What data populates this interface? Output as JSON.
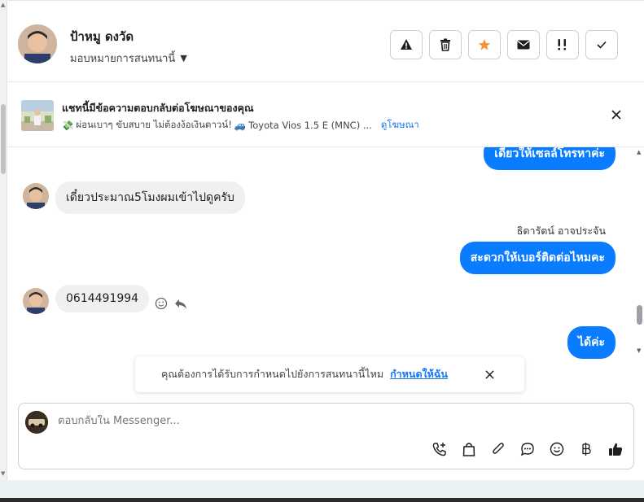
{
  "header": {
    "contact_name": "ป้าหมู ดงวัด",
    "assign_label": "มอบหมายการสนทนานี้"
  },
  "ad": {
    "title": "แชทนี้มีข้อความตอบกลับต่อโฆษณาของคุณ",
    "subtitle": "ผ่อนเบาๆ ขับสบาย ไม่ต้องง้อเงินดาวน์!",
    "car": "Toyota Vios 1.5 E (MNC) ...",
    "view_ad_link": "ดูโฆษณา"
  },
  "messages": [
    {
      "direction": "out",
      "text": "เดี๋ยวให้เซลล์โทรหาค่ะ"
    },
    {
      "direction": "in",
      "text": "เดี๋ยวประมาณ5โมงผมเข้าไปดูครับ"
    },
    {
      "direction": "out",
      "sender": "ธิดารัตน์ อาจประจัน",
      "text": "สะดวกให้เบอร์ติดต่อไหมคะ"
    },
    {
      "direction": "in",
      "text": "0614491994"
    },
    {
      "direction": "out",
      "text": "ได้ค่ะ"
    }
  ],
  "notice": {
    "text": "คุณต้องการได้รับการกำหนดไปยังการสนทนานี้ไหม",
    "link": "กำหนดให้ฉัน"
  },
  "composer": {
    "placeholder": "ตอบกลับใน Messenger..."
  },
  "colors": {
    "accent": "#0a7cff",
    "star": "#f7923a",
    "link": "#1877f2"
  }
}
